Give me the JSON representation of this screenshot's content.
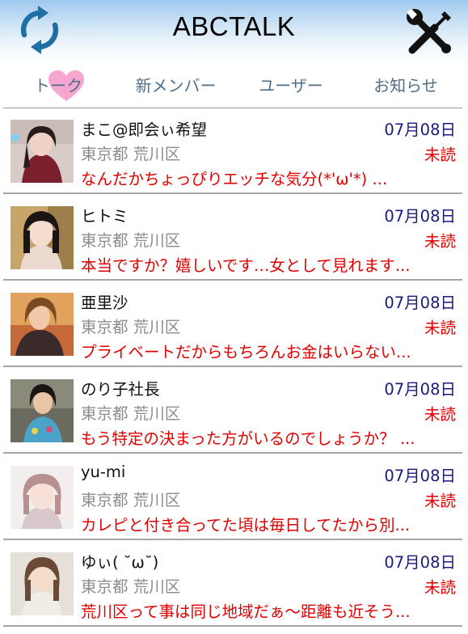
{
  "app": {
    "title": "ABCTALK"
  },
  "header": {
    "refresh_icon": "refresh-icon",
    "settings_icon": "tools-settings-icon"
  },
  "tabs": [
    {
      "label": "トーク",
      "active": true
    },
    {
      "label": "新メンバー",
      "active": false
    },
    {
      "label": "ユーザー",
      "active": false
    },
    {
      "label": "お知らせ",
      "active": false
    }
  ],
  "colors": {
    "accent_blue": "#1d6fa5",
    "unread_red": "#e00000",
    "date_navy": "#1a1a7e",
    "tab_text": "#4e6f8a",
    "heart_pink": "#f7a6d2"
  },
  "conversations": [
    {
      "name": "まこ@即会ぃ希望",
      "date": "07月08日",
      "location": "東京都 荒川区",
      "status": "未読",
      "message": "なんだかちょっぴりエッチな気分(*'ω'*) ..."
    },
    {
      "name": "ヒトミ",
      "date": "07月08日",
      "location": "東京都 荒川区",
      "status": "未読",
      "message": "本当ですか？嬉しいです…女として見れます..."
    },
    {
      "name": "亜里沙",
      "date": "07月08日",
      "location": "東京都 荒川区",
      "status": "未読",
      "message": "プライベートだからもちろんお金はいらない..."
    },
    {
      "name": "のり子社長",
      "date": "07月08日",
      "location": "東京都 荒川区",
      "status": "未読",
      "message": "もう特定の決まった方がいるのでしょうか？ ..."
    },
    {
      "name": "yu-mi",
      "date": "07月08日",
      "location": "東京都 荒川区",
      "status": "未読",
      "message": "カレピと付き合ってた頃は毎日してたから別..."
    },
    {
      "name": "ゆぃ( ˘ω˘)",
      "date": "07月08日",
      "location": "東京都 荒川区",
      "status": "未読",
      "message": "荒川区って事は同じ地域だぁ～距離も近そう..."
    }
  ]
}
